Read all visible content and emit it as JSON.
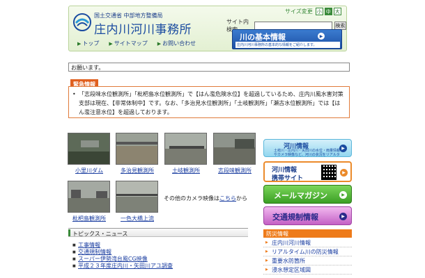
{
  "header": {
    "agency": "国土交通省 中部地方整備局",
    "office_title": "庄内川河川事務所",
    "nav": [
      {
        "label": "トップ"
      },
      {
        "label": "サイトマップ"
      },
      {
        "label": "お問い合わせ"
      }
    ],
    "font_size": {
      "label": "サイズ変更",
      "small": "小",
      "medium": "中",
      "large": "大"
    },
    "search": {
      "label": "サイト内検索",
      "value": "",
      "button": "検索"
    },
    "river_banner": {
      "title": "川の基本情報",
      "subtitle": "庄内川河川事務所の基本的な情報をご紹介します。"
    }
  },
  "ticker": {
    "text": "お願います。"
  },
  "alert": {
    "tag": "緊急情報",
    "text": "「志段味水位観測所」「枇杷島水位観測所」で【はん濫危険水位】を超過しているため、庄内川風水害対策支部は現在、【非常体制中】です。なお、「多治見水位観測所」「土岐観測所」「瀬古水位観測所」では【はん濫注意水位】を超過しております。"
  },
  "cameras": [
    {
      "label": "小里川ダム"
    },
    {
      "label": "多治見観測所"
    },
    {
      "label": "土岐観測所"
    },
    {
      "label": "志段味観測所"
    },
    {
      "label": "枇杷島観測所"
    },
    {
      "label": "一色大橋上流"
    }
  ],
  "camera_note": {
    "prefix": "その他のカメラ映像は",
    "link": "こちら",
    "suffix": "から"
  },
  "topics": {
    "heading": "トピックス・ニュース",
    "items": [
      {
        "label": "工事情報"
      },
      {
        "label": "交通規制情報"
      },
      {
        "label": "スーパー伊勢湾台風CG映像"
      },
      {
        "label": "平成２３年度庄内川・矢田川アユ調査"
      }
    ]
  },
  "sidebar": {
    "river_info": {
      "title": "河川情報",
      "subtitle": "土岐川・庄内川・矢田川の水位・雨量情報やカメラ映像など、河川の状況をリアルタイムでお届けします。"
    },
    "mobile": {
      "line1": "河川情報",
      "line2": "携帯サイト"
    },
    "mail": {
      "title": "メールマガジン"
    },
    "traffic": {
      "title": "交通規制情報"
    },
    "disaster": {
      "heading": "防災情報",
      "items": [
        {
          "label": "庄内川河川情報"
        },
        {
          "label": "リアルタイム川の防災情報"
        },
        {
          "label": "重要水防箇所"
        },
        {
          "label": "浸水想定区域図"
        }
      ]
    }
  },
  "colors": {
    "accent_green": "#3a8a3a",
    "brand_blue": "#1a4ba0",
    "alert_orange": "#e06020"
  }
}
